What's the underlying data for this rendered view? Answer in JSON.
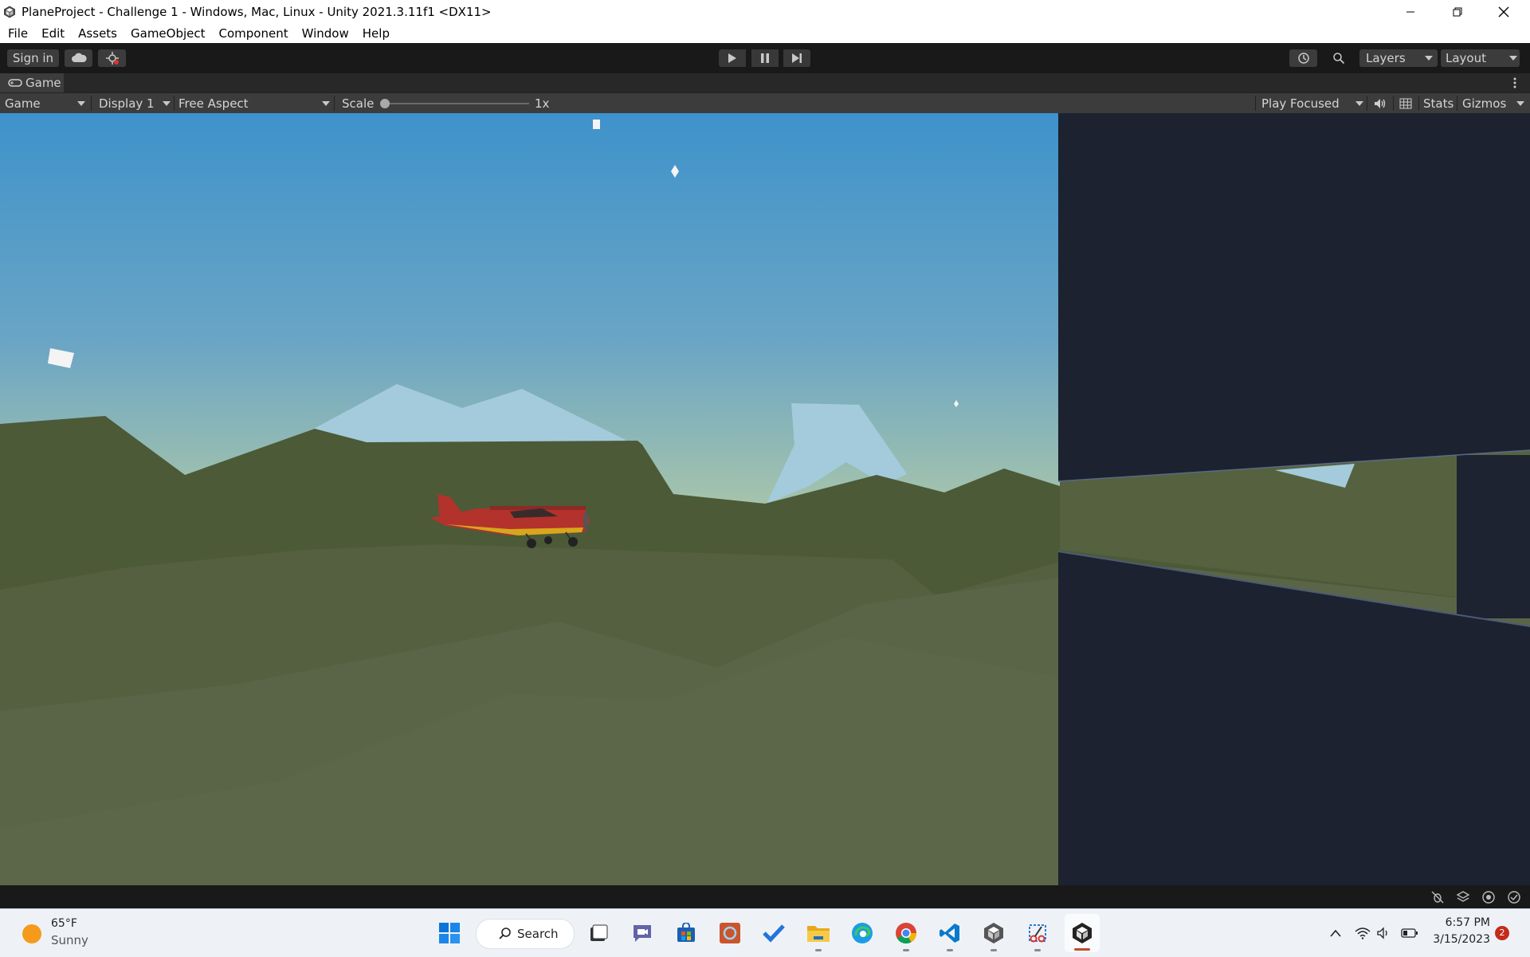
{
  "window": {
    "title": "PlaneProject - Challenge 1 - Windows, Mac, Linux - Unity 2021.3.11f1 <DX11>",
    "controls": [
      "minimize-icon",
      "restore-icon",
      "close-icon"
    ]
  },
  "menu": {
    "items": [
      "File",
      "Edit",
      "Assets",
      "GameObject",
      "Component",
      "Window",
      "Help"
    ]
  },
  "toolbar": {
    "sign_in": "Sign in",
    "layers": "Layers",
    "layout": "Layout",
    "icons": [
      "cloud-icon",
      "collab-icon",
      "play-icon",
      "pause-icon",
      "step-icon",
      "history-icon",
      "search-icon"
    ]
  },
  "game_tab": {
    "label": "Game",
    "icon": "gamepad-icon"
  },
  "game_toolbar": {
    "view_select": "Game",
    "display_select": "Display 1",
    "aspect_select": "Free Aspect",
    "scale_label": "Scale",
    "scale_value": "1x",
    "scale_fraction": 0.0,
    "play_mode": "Play Focused",
    "stats": "Stats",
    "gizmos": "Gizmos"
  },
  "scene": {
    "sky_top": "#3e92cb",
    "sky_bottom": "#a7c2a5",
    "hills_color": "#4c5a37",
    "snow_color": "#a4cbdc",
    "wall_color": "#1c2230",
    "plane_body": "#b3322b",
    "plane_stripe": "#d9a51c"
  },
  "taskbar": {
    "weather_temp": "65°F",
    "weather_text": "Sunny",
    "search_label": "Search",
    "time": "6:57 PM",
    "date": "3/15/2023",
    "notifications": "2"
  }
}
